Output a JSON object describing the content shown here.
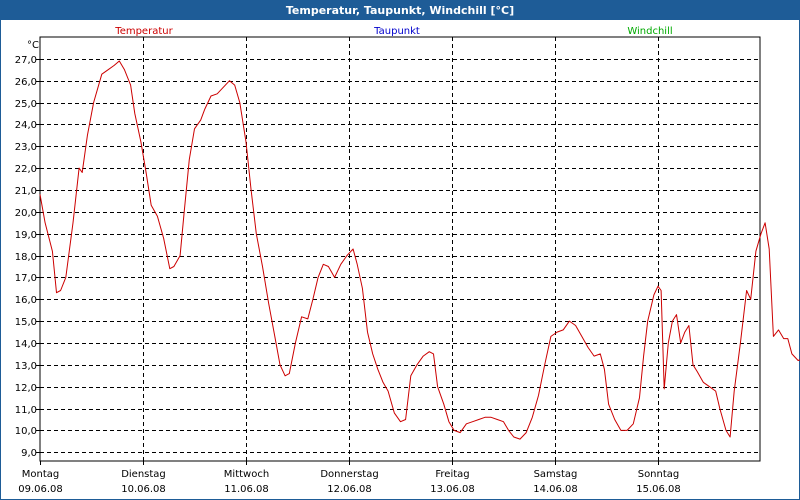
{
  "window": {
    "title": "Temperatur, Taupunkt, Windchill [°C]"
  },
  "colors": {
    "titlebar": "#1e5c97",
    "temperatur": "#cc0000",
    "taupunkt": "#0000cc",
    "windchill": "#00aa00"
  },
  "chart_data": {
    "type": "line",
    "title": "Temperatur, Taupunkt, Windchill [°C]",
    "ylabel": "°C",
    "ylim": [
      8.6,
      28.0
    ],
    "yticks": [
      9.0,
      10.0,
      11.0,
      12.0,
      13.0,
      14.0,
      15.0,
      16.0,
      17.0,
      18.0,
      19.0,
      20.0,
      21.0,
      22.0,
      23.0,
      24.0,
      25.0,
      26.0,
      27.0
    ],
    "ytick_labels": [
      "9,0",
      "10,0",
      "11,0",
      "12,0",
      "13,0",
      "14,0",
      "15,0",
      "16,0",
      "17,0",
      "18,0",
      "19,0",
      "20,0",
      "21,0",
      "22,0",
      "23,0",
      "24,0",
      "25,0",
      "26,0",
      "27,0"
    ],
    "x_range_days": [
      0,
      7
    ],
    "xticks": [
      {
        "day": "Montag",
        "date": "09.06.08"
      },
      {
        "day": "Dienstag",
        "date": "10.06.08"
      },
      {
        "day": "Mittwoch",
        "date": "11.06.08"
      },
      {
        "day": "Donnerstag",
        "date": "12.06.08"
      },
      {
        "day": "Freitag",
        "date": "13.06.08"
      },
      {
        "day": "Samstag",
        "date": "14.06.08"
      },
      {
        "day": "Sonntag",
        "date": "15.06.08"
      }
    ],
    "grid": true,
    "legend": [
      {
        "name": "Temperatur",
        "color": "#cc0000"
      },
      {
        "name": "Taupunkt",
        "color": "#0000cc"
      },
      {
        "name": "Windchill",
        "color": "#00aa00"
      }
    ],
    "series": [
      {
        "name": "Temperatur",
        "color": "#cc0000",
        "points": [
          [
            0.0,
            20.8
          ],
          [
            0.05,
            19.5
          ],
          [
            0.12,
            18.2
          ],
          [
            0.16,
            16.3
          ],
          [
            0.2,
            16.4
          ],
          [
            0.25,
            17.0
          ],
          [
            0.32,
            19.5
          ],
          [
            0.38,
            22.0
          ],
          [
            0.41,
            21.8
          ],
          [
            0.46,
            23.5
          ],
          [
            0.52,
            25.0
          ],
          [
            0.6,
            26.3
          ],
          [
            0.66,
            26.5
          ],
          [
            0.72,
            26.7
          ],
          [
            0.77,
            26.9
          ],
          [
            0.82,
            26.5
          ],
          [
            0.88,
            25.8
          ],
          [
            0.92,
            24.5
          ],
          [
            0.98,
            23.2
          ],
          [
            1.03,
            21.8
          ],
          [
            1.08,
            20.3
          ],
          [
            1.14,
            19.8
          ],
          [
            1.2,
            18.8
          ],
          [
            1.26,
            17.4
          ],
          [
            1.3,
            17.5
          ],
          [
            1.36,
            18.0
          ],
          [
            1.4,
            20.0
          ],
          [
            1.45,
            22.4
          ],
          [
            1.5,
            23.8
          ],
          [
            1.56,
            24.2
          ],
          [
            1.6,
            24.7
          ],
          [
            1.66,
            25.3
          ],
          [
            1.72,
            25.4
          ],
          [
            1.78,
            25.7
          ],
          [
            1.84,
            26.0
          ],
          [
            1.89,
            25.8
          ],
          [
            1.94,
            25.0
          ],
          [
            2.0,
            23.2
          ],
          [
            2.05,
            21.0
          ],
          [
            2.1,
            19.0
          ],
          [
            2.16,
            17.5
          ],
          [
            2.22,
            15.8
          ],
          [
            2.28,
            14.3
          ],
          [
            2.33,
            13.0
          ],
          [
            2.38,
            12.5
          ],
          [
            2.42,
            12.6
          ],
          [
            2.48,
            14.0
          ],
          [
            2.54,
            15.2
          ],
          [
            2.6,
            15.1
          ],
          [
            2.65,
            16.0
          ],
          [
            2.7,
            17.0
          ],
          [
            2.75,
            17.6
          ],
          [
            2.8,
            17.5
          ],
          [
            2.86,
            17.0
          ],
          [
            2.92,
            17.6
          ],
          [
            2.98,
            18.0
          ],
          [
            3.04,
            18.3
          ],
          [
            3.08,
            17.6
          ],
          [
            3.13,
            16.5
          ],
          [
            3.18,
            14.5
          ],
          [
            3.23,
            13.5
          ],
          [
            3.28,
            12.8
          ],
          [
            3.33,
            12.2
          ],
          [
            3.38,
            11.8
          ],
          [
            3.44,
            10.8
          ],
          [
            3.5,
            10.4
          ],
          [
            3.55,
            10.5
          ],
          [
            3.6,
            12.5
          ],
          [
            3.66,
            13.0
          ],
          [
            3.72,
            13.4
          ],
          [
            3.78,
            13.6
          ],
          [
            3.82,
            13.5
          ],
          [
            3.86,
            12.0
          ],
          [
            3.92,
            11.2
          ],
          [
            3.97,
            10.4
          ],
          [
            4.02,
            10.0
          ],
          [
            4.08,
            9.9
          ],
          [
            4.14,
            10.3
          ],
          [
            4.2,
            10.4
          ],
          [
            4.26,
            10.5
          ],
          [
            4.32,
            10.6
          ],
          [
            4.38,
            10.6
          ],
          [
            4.44,
            10.5
          ],
          [
            4.5,
            10.4
          ],
          [
            4.55,
            10.0
          ],
          [
            4.6,
            9.7
          ],
          [
            4.66,
            9.6
          ],
          [
            4.72,
            9.9
          ],
          [
            4.78,
            10.6
          ],
          [
            4.84,
            11.6
          ],
          [
            4.9,
            13.0
          ],
          [
            4.96,
            14.3
          ],
          [
            5.02,
            14.5
          ],
          [
            5.08,
            14.6
          ],
          [
            5.14,
            15.0
          ],
          [
            5.2,
            14.8
          ],
          [
            5.26,
            14.3
          ],
          [
            5.32,
            13.8
          ],
          [
            5.38,
            13.4
          ],
          [
            5.44,
            13.5
          ],
          [
            5.48,
            12.8
          ],
          [
            5.52,
            11.2
          ],
          [
            5.58,
            10.5
          ],
          [
            5.64,
            10.0
          ],
          [
            5.7,
            10.0
          ],
          [
            5.76,
            10.3
          ],
          [
            5.82,
            11.5
          ],
          [
            5.86,
            13.4
          ],
          [
            5.9,
            15.0
          ],
          [
            5.96,
            16.2
          ],
          [
            6.0,
            16.6
          ],
          [
            6.03,
            16.4
          ],
          [
            6.06,
            11.9
          ],
          [
            6.1,
            14.0
          ],
          [
            6.14,
            15.0
          ],
          [
            6.18,
            15.3
          ],
          [
            6.22,
            14.0
          ],
          [
            6.26,
            14.5
          ],
          [
            6.3,
            14.8
          ],
          [
            6.34,
            13.0
          ],
          [
            6.38,
            12.7
          ],
          [
            6.44,
            12.2
          ],
          [
            6.5,
            12.0
          ],
          [
            6.56,
            11.8
          ],
          [
            6.6,
            11.0
          ],
          [
            6.66,
            10.0
          ],
          [
            6.7,
            9.7
          ],
          [
            6.74,
            11.8
          ],
          [
            6.8,
            14.0
          ],
          [
            6.86,
            16.4
          ],
          [
            6.9,
            16.0
          ],
          [
            6.95,
            18.2
          ],
          [
            7.0,
            19.0
          ],
          [
            7.04,
            19.5
          ],
          [
            7.08,
            18.3
          ],
          [
            7.12,
            14.3
          ],
          [
            7.17,
            14.6
          ],
          [
            7.22,
            14.2
          ],
          [
            7.26,
            14.2
          ],
          [
            7.3,
            13.5
          ],
          [
            7.36,
            13.2
          ],
          [
            7.42,
            13.3
          ]
        ]
      }
    ]
  }
}
